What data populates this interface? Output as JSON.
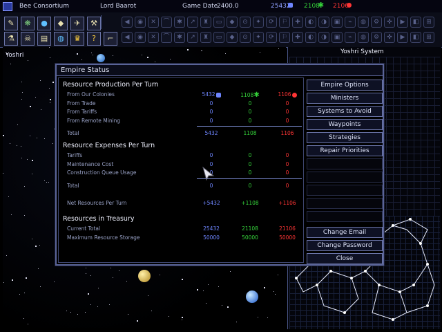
{
  "topbar": {
    "empire": "Bee Consortium",
    "leader": "Lord Baarot",
    "game_date_label": "Game Date",
    "game_date": "2400.0",
    "res1": "25432",
    "res2": "2108",
    "res3": "2106"
  },
  "map": {
    "sector_label": "Yoshri",
    "system_title": "Yoshri System"
  },
  "dialog": {
    "title": "Empire Status",
    "production": {
      "heading": "Resource Production Per Turn",
      "rows": [
        {
          "label": "From Our Colonies",
          "v1": "5432",
          "v2": "1108",
          "v3": "1106"
        },
        {
          "label": "From Trade",
          "v1": "0",
          "v2": "0",
          "v3": "0"
        },
        {
          "label": "From Tariffs",
          "v1": "0",
          "v2": "0",
          "v3": "0"
        },
        {
          "label": "From Remote Mining",
          "v1": "0",
          "v2": "0",
          "v3": "0"
        }
      ],
      "total": {
        "label": "Total",
        "v1": "5432",
        "v2": "1108",
        "v3": "1106"
      }
    },
    "expenses": {
      "heading": "Resource Expenses Per Turn",
      "rows": [
        {
          "label": "Tariffs",
          "v1": "0",
          "v2": "0",
          "v3": "0"
        },
        {
          "label": "Maintenance Cost",
          "v1": "0",
          "v2": "0",
          "v3": "0"
        },
        {
          "label": "Construction Queue Usage",
          "v1": "0",
          "v2": "0",
          "v3": "0"
        }
      ],
      "total": {
        "label": "Total",
        "v1": "0",
        "v2": "0",
        "v3": "0"
      }
    },
    "net": {
      "label": "Net Resources Per Turn",
      "v1": "+5432",
      "v2": "+1108",
      "v3": "+1106"
    },
    "treasury": {
      "heading": "Resources in Treasury",
      "rows": [
        {
          "label": "Current Total",
          "v1": "25432",
          "v2": "21108",
          "v3": "21106"
        },
        {
          "label": "Maximum Resource Storage",
          "v1": "50000",
          "v2": "50000",
          "v3": "50000"
        }
      ]
    },
    "buttons": {
      "empire_options": "Empire Options",
      "ministers": "Ministers",
      "systems_to_avoid": "Systems to Avoid",
      "waypoints": "Waypoints",
      "strategies": "Strategies",
      "repair_priorities": "Repair Priorities",
      "change_email": "Change Email",
      "change_password": "Change Password",
      "close": "Close"
    }
  },
  "colors": {
    "mineral": "#6f86ff",
    "organic": "#35d23a",
    "radioactive": "#ff3535",
    "frame": "#5a6498"
  },
  "icons": {
    "toolbar_left": [
      "notes-icon",
      "species-icon",
      "planet-icon",
      "ship-icon",
      "design-icon",
      "wrench-icon",
      "lab-icon",
      "skull-icon",
      "book-icon",
      "globe-icon",
      "crown-icon",
      "help-icon",
      "settings-icon"
    ]
  }
}
